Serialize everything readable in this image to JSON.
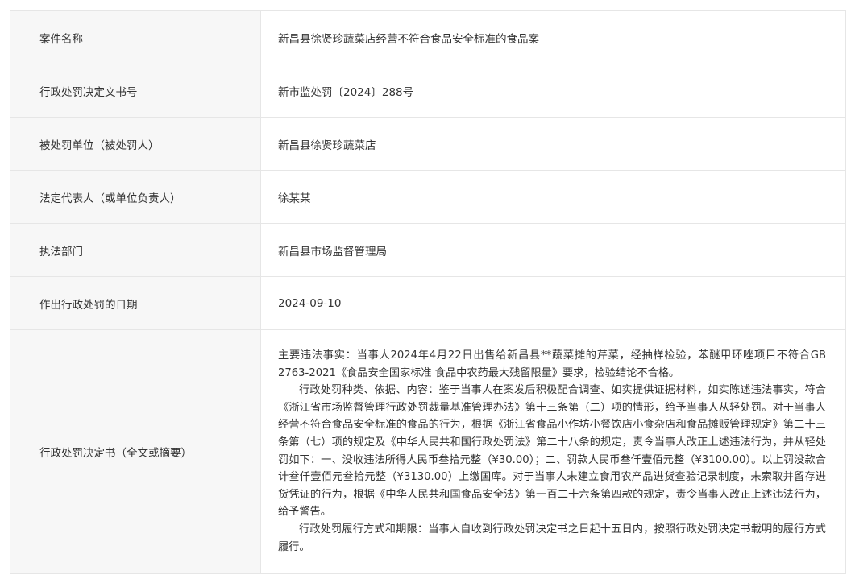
{
  "rows": [
    {
      "label": "案件名称",
      "value": "新昌县徐贤珍蔬菜店经营不符合食品安全标准的食品案"
    },
    {
      "label": "行政处罚决定文书号",
      "value": "新市监处罚〔2024〕288号"
    },
    {
      "label": "被处罚单位（被处罚人）",
      "value": "新昌县徐贤珍蔬菜店"
    },
    {
      "label": "法定代表人（或单位负责人）",
      "value": "徐某某"
    },
    {
      "label": "执法部门",
      "value": "新昌县市场监督管理局"
    },
    {
      "label": "作出行政处罚的日期",
      "value": "2024-09-10"
    }
  ],
  "decision": {
    "label": "行政处罚决定书（全文或摘要）",
    "paragraphs": [
      "主要违法事实：当事人2024年4月22日出售给新昌县**蔬菜摊的芹菜，经抽样检验，苯醚甲环唑项目不符合GB 2763-2021《食品安全国家标准 食品中农药最大残留限量》要求，检验结论不合格。",
      "行政处罚种类、依据、内容：鉴于当事人在案发后积极配合调查、如实提供证据材料，如实陈述违法事实，符合《浙江省市场监督管理行政处罚裁量基准管理办法》第十三条第（二）项的情形，给予当事人从轻处罚。对于当事人经营不符合食品安全标准的食品的行为，根据《浙江省食品小作坊小餐饮店小食杂店和食品摊贩管理规定》第二十三条第（七）项的规定及《中华人民共和国行政处罚法》第二十八条的规定，责令当事人改正上述违法行为，并从轻处罚如下：一、没收违法所得人民币叁拾元整（¥30.00）；二、罚款人民币叁仟壹佰元整（¥3100.00）。以上罚没款合计叁仟壹佰元叁拾元整（¥3130.00）上缴国库。对于当事人未建立食用农产品进货查验记录制度，未索取并留存进货凭证的行为，根据《中华人民共和国食品安全法》第一百二十六条第四款的规定，责令当事人改正上述违法行为，给予警告。",
      "行政处罚履行方式和期限：当事人自收到行政处罚决定书之日起十五日内，按照行政处罚决定书载明的履行方式履行。"
    ]
  }
}
